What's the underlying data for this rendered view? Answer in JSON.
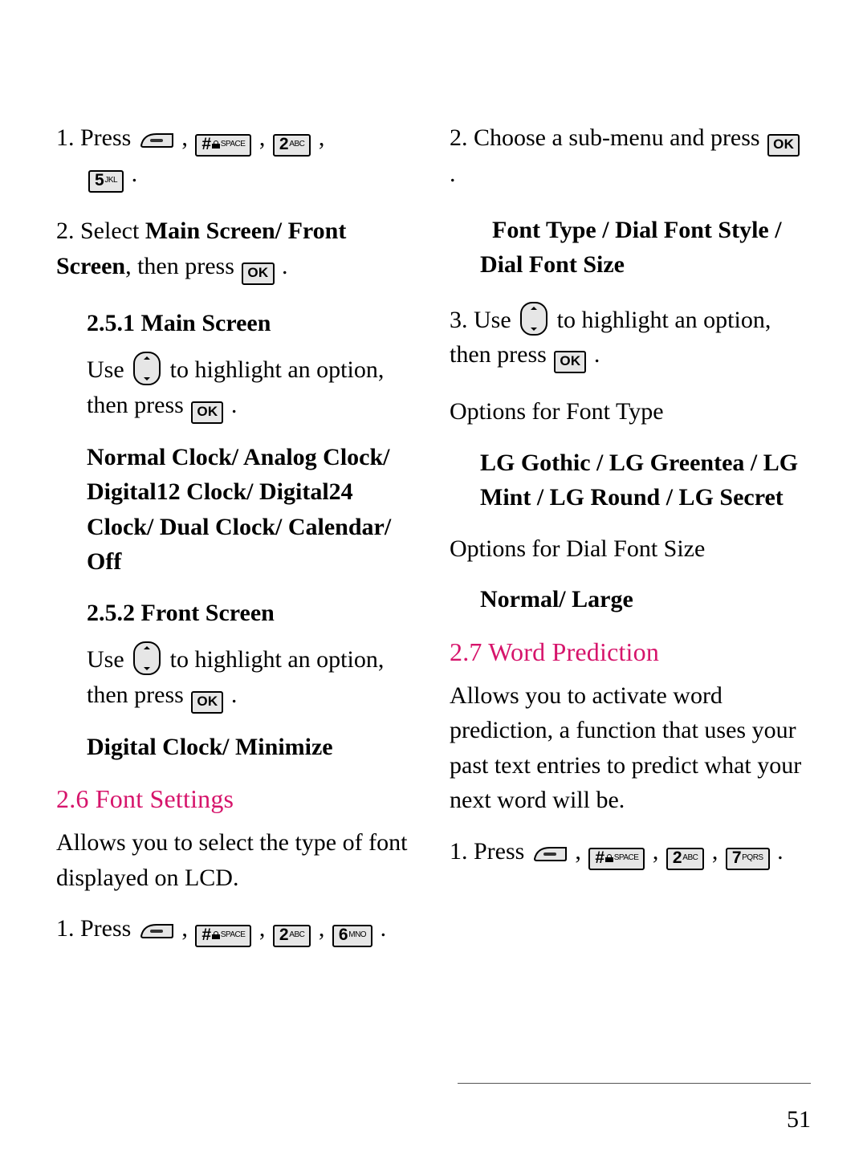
{
  "page_number": "51",
  "keys": {
    "hash": {
      "big": "#",
      "tiny": "SPACE"
    },
    "k2": {
      "big": "2",
      "tiny": "ABC"
    },
    "k5": {
      "big": "5",
      "tiny": "JKL"
    },
    "k6": {
      "big": "6",
      "tiny": "MNO"
    },
    "k7": {
      "big": "7",
      "tiny": "PQRS"
    },
    "ok": "OK"
  },
  "left": {
    "s1_press": "1. Press",
    "s2a": "2. Select ",
    "s2b": "Main Screen/ Front Screen",
    "s2c": ", then press ",
    "h251": "2.5.1 Main Screen",
    "use_a": "Use ",
    "use_b": " to highlight an option, then press ",
    "clock_list": "Normal Clock/ Analog Clock/ Digital12 Clock/ Digital24 Clock/ Dual Clock/ Calendar/ Off",
    "h252": "2.5.2 Front Screen",
    "front_list": "Digital Clock/ Minimize",
    "h26": "2.6 Font Settings",
    "h26_desc": "Allows you to select the type of font displayed on LCD.",
    "s26_press": "1. Press"
  },
  "right": {
    "s2a": "2. Choose a sub-menu and press ",
    "font_menu": "Font Type / Dial Font Style / Dial Font Size",
    "s3a": "3. Use ",
    "s3b": " to highlight an option, then press ",
    "opt_ft_label": "Options for Font Type",
    "opt_ft": "LG Gothic / LG Greentea / LG Mint / LG Round / LG Secret",
    "opt_dfs_label": "Options for Dial Font Size",
    "opt_dfs": "Normal/ Large",
    "h27": "2.7 Word Prediction",
    "h27_desc": "Allows you to activate word prediction, a function that uses your past text entries to predict what your next word will be.",
    "s27_press": "1. Press"
  }
}
